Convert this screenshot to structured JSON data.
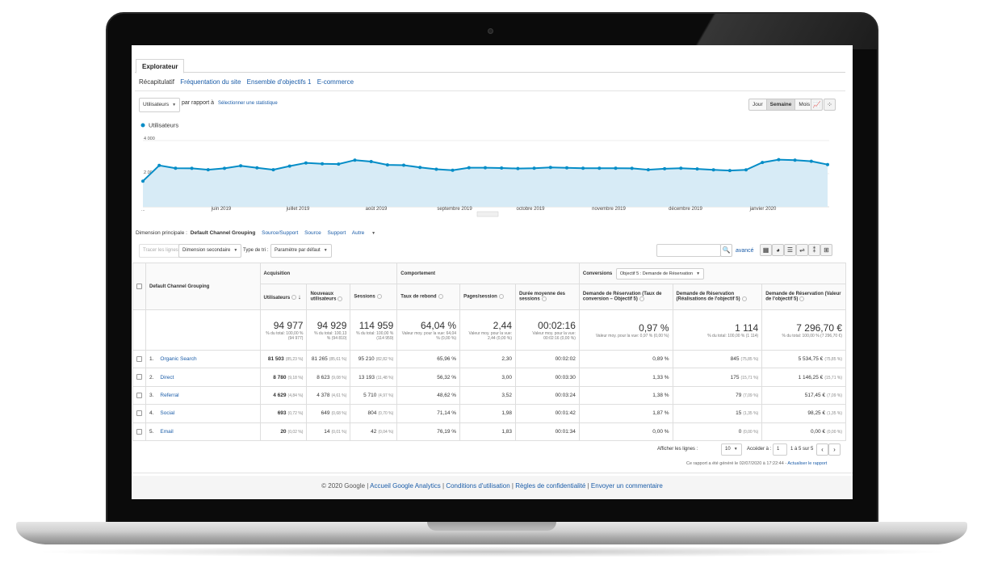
{
  "app": {
    "tab": "Explorateur",
    "subtabs": [
      "Récapitulatif",
      "Fréquentation du site",
      "Ensemble d'objectifs 1",
      "E-commerce"
    ]
  },
  "controls": {
    "metric_select": "Utilisateurs",
    "compare_label": "par rapport à",
    "compare_link": "Sélectionner une statistique",
    "granularity": [
      "Jour",
      "Semaine",
      "Mois"
    ],
    "granularity_active": "Semaine"
  },
  "chart_data": {
    "type": "area",
    "series": [
      {
        "name": "Utilisateurs",
        "color": "#058dc7",
        "values": [
          1550,
          2500,
          2330,
          2320,
          2240,
          2320,
          2480,
          2350,
          2240,
          2460,
          2650,
          2600,
          2580,
          2820,
          2730,
          2530,
          2510,
          2380,
          2270,
          2210,
          2360,
          2360,
          2340,
          2310,
          2330,
          2380,
          2350,
          2330,
          2330,
          2330,
          2320,
          2240,
          2300,
          2330,
          2290,
          2230,
          2190,
          2230,
          2680,
          2850,
          2820,
          2750,
          2550
        ]
      }
    ],
    "x_labels": [
      "juin 2019",
      "juillet 2019",
      "août 2019",
      "septembre 2019",
      "octobre 2019",
      "novembre 2019",
      "décembre 2019",
      "janvier 2020"
    ],
    "y_ticks": [
      "4 000",
      "2 000",
      "..."
    ],
    "ylim": [
      0,
      4000
    ],
    "legend": "Utilisateurs"
  },
  "dimension": {
    "label": "Dimension principale :",
    "active": "Default Channel Grouping",
    "options": [
      "Source/Support",
      "Source",
      "Support",
      "Autre"
    ]
  },
  "toolbar": {
    "plot_rows": "Tracer les lignes",
    "secondary_dim": "Dimension secondaire",
    "sort_label": "Type de tri :",
    "sort_value": "Paramètre par défaut",
    "search_placeholder": "",
    "advanced": "avancé"
  },
  "table": {
    "col_channel": "Default Channel Grouping",
    "group_acq": "Acquisition",
    "group_beh": "Comportement",
    "group_conv": "Conversions",
    "goal_select": "Objectif 5 : Demande de Réservation",
    "headers": [
      "Utilisateurs",
      "Nouveaux utilisateurs",
      "Sessions",
      "Taux de rebond",
      "Pages/session",
      "Durée moyenne des sessions",
      "Demande de Réservation (Taux de conversion – Objectif 5)",
      "Demande de Réservation (Réalisations de l'objectif 5)",
      "Demande de Réservation (Valeur de l'objectif 5)"
    ],
    "totals": [
      {
        "value": "94 977",
        "sub": "% du total: 100,00 % (94 977)"
      },
      {
        "value": "94 929",
        "sub": "% du total: 100,13 % (94 810)"
      },
      {
        "value": "114 959",
        "sub": "% du total: 100,00 % (114 959)"
      },
      {
        "value": "64,04 %",
        "sub": "Valeur moy. pour la vue: 64,04 % (0,00 %)"
      },
      {
        "value": "2,44",
        "sub": "Valeur moy. pour la vue: 2,44 (0,00 %)"
      },
      {
        "value": "00:02:16",
        "sub": "Valeur moy. pour la vue: 00:02:16 (0,00 %)"
      },
      {
        "value": "0,97 %",
        "sub": "Valeur moy. pour la vue: 0,97 % (0,00 %)"
      },
      {
        "value": "1 114",
        "sub": "% du total: 100,00 % (1 114)"
      },
      {
        "value": "7 296,70 €",
        "sub": "% du total: 100,00 % (7 296,70 €)"
      }
    ],
    "rows": [
      {
        "idx": "1.",
        "name": "Organic Search",
        "users": "81 503",
        "users_pct": "(85,23 %)",
        "new": "81 265",
        "new_pct": "(85,61 %)",
        "sessions": "95 210",
        "sessions_pct": "(82,82 %)",
        "bounce": "65,96 %",
        "pages": "2,30",
        "duration": "00:02:02",
        "conv": "0,89 %",
        "goals": "845",
        "goals_pct": "(75,85 %)",
        "value": "5 534,75 €",
        "value_pct": "(75,85 %)"
      },
      {
        "idx": "2.",
        "name": "Direct",
        "users": "8 780",
        "users_pct": "(9,18 %)",
        "new": "8 623",
        "new_pct": "(9,08 %)",
        "sessions": "13 193",
        "sessions_pct": "(11,48 %)",
        "bounce": "56,32 %",
        "pages": "3,00",
        "duration": "00:03:30",
        "conv": "1,33 %",
        "goals": "175",
        "goals_pct": "(15,71 %)",
        "value": "1 146,25 €",
        "value_pct": "(15,71 %)"
      },
      {
        "idx": "3.",
        "name": "Referral",
        "users": "4 629",
        "users_pct": "(4,84 %)",
        "new": "4 378",
        "new_pct": "(4,61 %)",
        "sessions": "5 710",
        "sessions_pct": "(4,97 %)",
        "bounce": "48,62 %",
        "pages": "3,52",
        "duration": "00:03:24",
        "conv": "1,38 %",
        "goals": "79",
        "goals_pct": "(7,09 %)",
        "value": "517,45 €",
        "value_pct": "(7,09 %)"
      },
      {
        "idx": "4.",
        "name": "Social",
        "users": "693",
        "users_pct": "(0,72 %)",
        "new": "649",
        "new_pct": "(0,68 %)",
        "sessions": "804",
        "sessions_pct": "(0,70 %)",
        "bounce": "71,14 %",
        "pages": "1,98",
        "duration": "00:01:42",
        "conv": "1,87 %",
        "goals": "15",
        "goals_pct": "(1,35 %)",
        "value": "98,25 €",
        "value_pct": "(1,35 %)"
      },
      {
        "idx": "5.",
        "name": "Email",
        "users": "20",
        "users_pct": "(0,02 %)",
        "new": "14",
        "new_pct": "(0,01 %)",
        "sessions": "42",
        "sessions_pct": "(0,04 %)",
        "bounce": "76,19 %",
        "pages": "1,83",
        "duration": "00:01:34",
        "conv": "0,00 %",
        "goals": "0",
        "goals_pct": "(0,00 %)",
        "value": "0,00 €",
        "value_pct": "(0,00 %)"
      }
    ]
  },
  "pagination": {
    "show_rows": "Afficher les lignes :",
    "rows_value": "10",
    "goto": "Accéder à :",
    "goto_value": "1",
    "range": "1 à 5 sur 5",
    "prev": "‹",
    "next": "›",
    "generated": "Ce rapport a été généré le 02/07/2020 à 17:22:44 -",
    "refresh": "Actualiser le rapport"
  },
  "footer": {
    "copyright": "© 2020 Google",
    "links": [
      "Accueil Google Analytics",
      "Conditions d'utilisation",
      "Règles de confidentialité",
      "Envoyer un commentaire"
    ]
  }
}
